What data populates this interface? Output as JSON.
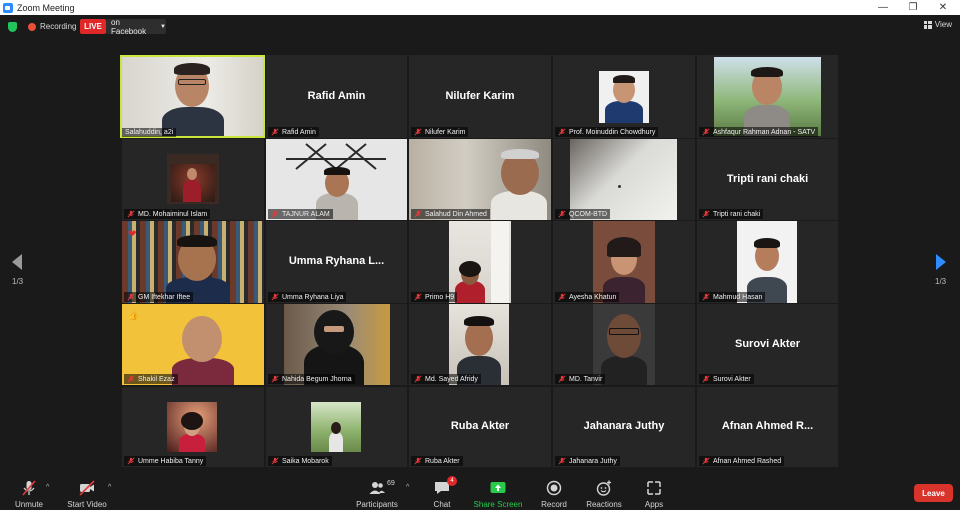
{
  "window": {
    "title": "Zoom Meeting",
    "minimize": "—",
    "maximize": "❐",
    "close": "✕"
  },
  "topbar": {
    "recording_label": "Recording",
    "live_label": "LIVE",
    "facebook_label": "on Facebook",
    "view_label": "View"
  },
  "paging": {
    "left_label": "1/3",
    "right_label": "1/3"
  },
  "participants": [
    {
      "name": "Salahuddin, a2i",
      "big": "",
      "muted": false
    },
    {
      "name": "Rafid Amin",
      "big": "Rafid Amin",
      "muted": true
    },
    {
      "name": "Nilufer Karim",
      "big": "Nilufer Karim",
      "muted": true
    },
    {
      "name": "Prof. Moinuddin Chowdhury",
      "big": "",
      "muted": true
    },
    {
      "name": "Ashfaqur Rahman Adnan - SATV",
      "big": "",
      "muted": true
    },
    {
      "name": "MD. Mohaiminul Islam",
      "big": "",
      "muted": true
    },
    {
      "name": "TAJNUR ALAM",
      "big": "",
      "muted": true
    },
    {
      "name": "Salahud Din Ahmed",
      "big": "",
      "muted": true
    },
    {
      "name": "QCOM-BTD",
      "big": "",
      "muted": true
    },
    {
      "name": "Tripti rani chaki",
      "big": "Tripti rani chaki",
      "muted": true
    },
    {
      "name": "GM Iftekhar Iftee",
      "big": "",
      "muted": true
    },
    {
      "name": "Umma Ryhana Liya",
      "big": "Umma  Ryhana  L...",
      "muted": true
    },
    {
      "name": "Primo H9",
      "big": "",
      "muted": true
    },
    {
      "name": "Ayesha Khatun",
      "big": "",
      "muted": true
    },
    {
      "name": "Mahmud Hasan",
      "big": "",
      "muted": true
    },
    {
      "name": "Shakil Ezaz",
      "big": "",
      "muted": true
    },
    {
      "name": "Nahida Begum Jhorna",
      "big": "",
      "muted": true
    },
    {
      "name": "Md. Sayed Afridy",
      "big": "",
      "muted": true
    },
    {
      "name": "MD. Tanvir",
      "big": "",
      "muted": true
    },
    {
      "name": "Surovi Akter",
      "big": "Surovi Akter",
      "muted": true
    },
    {
      "name": "Umme Habiba Tanny",
      "big": "",
      "muted": true
    },
    {
      "name": "Saika Mobarok",
      "big": "",
      "muted": true
    },
    {
      "name": "Ruba Akter",
      "big": "Ruba Akter",
      "muted": true
    },
    {
      "name": "Jahanara Juthy",
      "big": "Jahanara Juthy",
      "muted": true
    },
    {
      "name": "Afnan Ahmed Rashed",
      "big": "Afnan  Ahmed  R...",
      "muted": true
    }
  ],
  "toolbar": {
    "unmute": "Unmute",
    "start_video": "Start Video",
    "participants": "Participants",
    "participants_count": "69",
    "chat": "Chat",
    "chat_badge": "4",
    "share_screen": "Share Screen",
    "record": "Record",
    "reactions": "Reactions",
    "apps": "Apps",
    "leave": "Leave"
  },
  "colors": {
    "active_speaker": "#c8e63c",
    "live": "#e02828",
    "share": "#29c94b",
    "leave": "#d9342b",
    "muted_mic": "#e23a3a"
  }
}
